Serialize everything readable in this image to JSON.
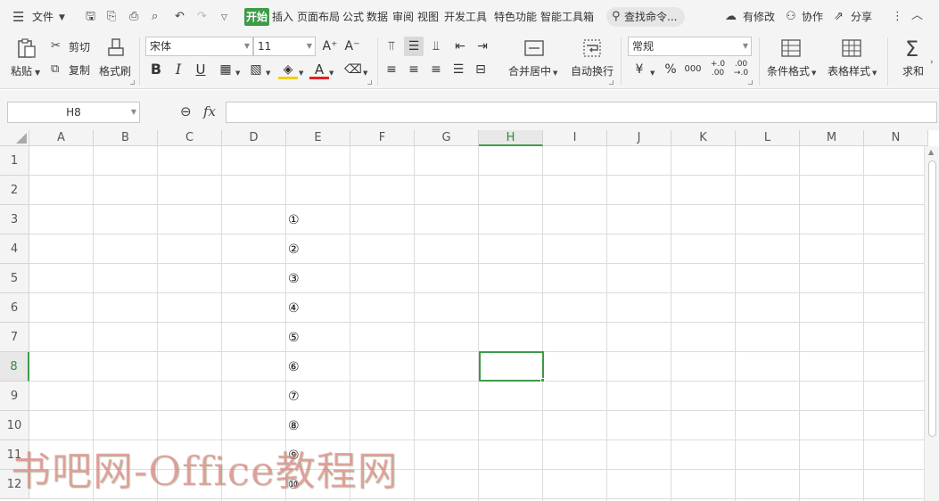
{
  "menubar": {
    "file": "文件",
    "tabs": [
      {
        "label": "开始",
        "active": true
      },
      {
        "label": "插入"
      },
      {
        "label": "页面布局"
      },
      {
        "label": "公式"
      },
      {
        "label": "数据"
      },
      {
        "label": "审阅"
      },
      {
        "label": "视图"
      },
      {
        "label": "开发工具"
      },
      {
        "label": "特色功能"
      },
      {
        "label": "智能工具箱"
      }
    ],
    "search": "查找命令...",
    "has_changes": "有修改",
    "collaborate": "协作",
    "share": "分享",
    "accent_color": "#3e9b47"
  },
  "ribbon": {
    "paste": "粘贴",
    "cut": "剪切",
    "copy": "复制",
    "format_painter": "格式刷",
    "font_name": "宋体",
    "font_size": "11",
    "merge_center": "合并居中",
    "wrap_text": "自动换行",
    "number_format": "常规",
    "conditional_format": "条件格式",
    "table_style": "表格样式",
    "sum": "求和",
    "grow_font": "A⁺",
    "shrink_font": "A⁻",
    "bold": "B",
    "italic": "I",
    "underline": "U",
    "font_color_letter": "A",
    "currency": "¥",
    "percent": "%",
    "thousands": "000",
    "inc_decimal": "+.0\n.00",
    "dec_decimal": ".00\n→.0"
  },
  "formula_bar": {
    "cell_ref": "H8",
    "fx": "fx",
    "value": ""
  },
  "grid": {
    "columns": [
      "A",
      "B",
      "C",
      "D",
      "E",
      "F",
      "G",
      "H",
      "I",
      "J",
      "K",
      "L",
      "M",
      "N"
    ],
    "rows": [
      "1",
      "2",
      "3",
      "4",
      "5",
      "6",
      "7",
      "8",
      "9",
      "10",
      "11",
      "12"
    ],
    "active_col": "H",
    "active_row": "8",
    "column_e": [
      "①",
      "②",
      "③",
      "④",
      "⑤",
      "⑥",
      "⑦",
      "⑧",
      "⑨",
      "⑩"
    ]
  },
  "watermark": "书吧网-Office教程网"
}
